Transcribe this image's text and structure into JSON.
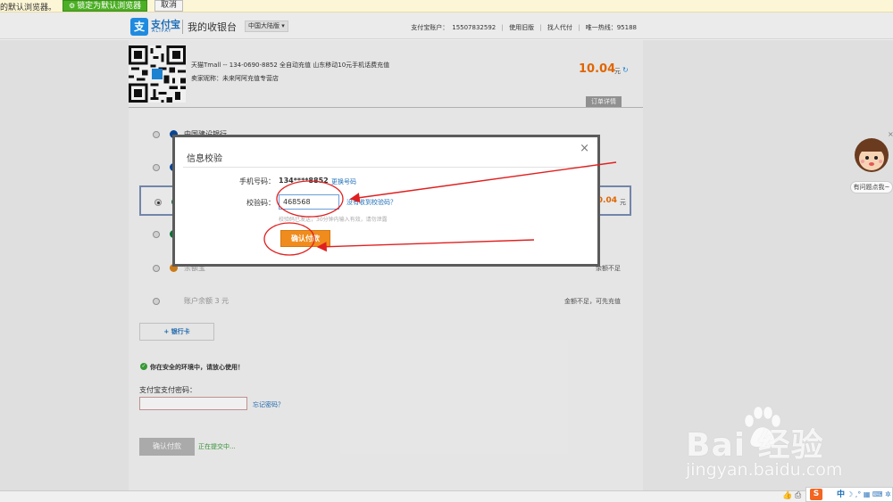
{
  "browser_notice": {
    "text": "的默认浏览器。",
    "lock_default_label": "锁定为默认浏览器",
    "cancel_label": "取消"
  },
  "header": {
    "brand": "支付宝",
    "brand_en": "ALIPAY",
    "title": "我的收银台",
    "region": "中国大陆版 ▾",
    "account_label": "支付宝账户：",
    "account_value": "15507832592",
    "use_old": "使用旧版",
    "pay_for_others": "找人代付",
    "hotline": "唯一热线：95188"
  },
  "order": {
    "title": "天猫Tmall -- 134-0690-8852 全自动充值 山东移动10元手机话费充值",
    "seller": "卖家昵称：未来阿阿充值专营店",
    "amount": "10.04",
    "amount_unit": "元",
    "detail_tab": "订单详情"
  },
  "payment_rows": [
    {
      "label": "中国建设银行",
      "right": ""
    },
    {
      "label": "",
      "right": ""
    },
    {
      "label": "",
      "amount": "10.04",
      "unit": "元",
      "selected": true
    },
    {
      "label": "",
      "right": ""
    },
    {
      "label": "余额宝",
      "right": "余额不足"
    },
    {
      "label": "账户余额 3 元",
      "right": "金额不足，可先充值"
    }
  ],
  "add_card": "+ 银行卡",
  "safe_text": "你在安全的环境中，请放心使用！",
  "password": {
    "label": "支付宝支付密码：",
    "forgot": "忘记密码？"
  },
  "bottom": {
    "confirm_label": "确认付款",
    "submitting": "正在提交中..."
  },
  "modal": {
    "title": "信息校验",
    "close": "×",
    "phone_label": "手机号码：",
    "phone_value": "134****8852",
    "change_phone": "更换号码",
    "code_label": "校验码：",
    "code_value": "468568",
    "no_code": "没有收到校验码？",
    "code_hint": "校验码已发送，30分钟内输入有效，请勿泄露",
    "confirm_label": "确认付款"
  },
  "helper": {
    "bubble": "有问题点我~",
    "close": "×"
  },
  "watermark": {
    "logo": "Bai  经验",
    "url": "jingyan.baidu.com"
  },
  "ime": {
    "s": "S",
    "lang": "中"
  },
  "colors": {
    "accent_orange": "#f08c1d",
    "alipay_blue": "#1f8be0",
    "annotation_red": "#e02020"
  }
}
